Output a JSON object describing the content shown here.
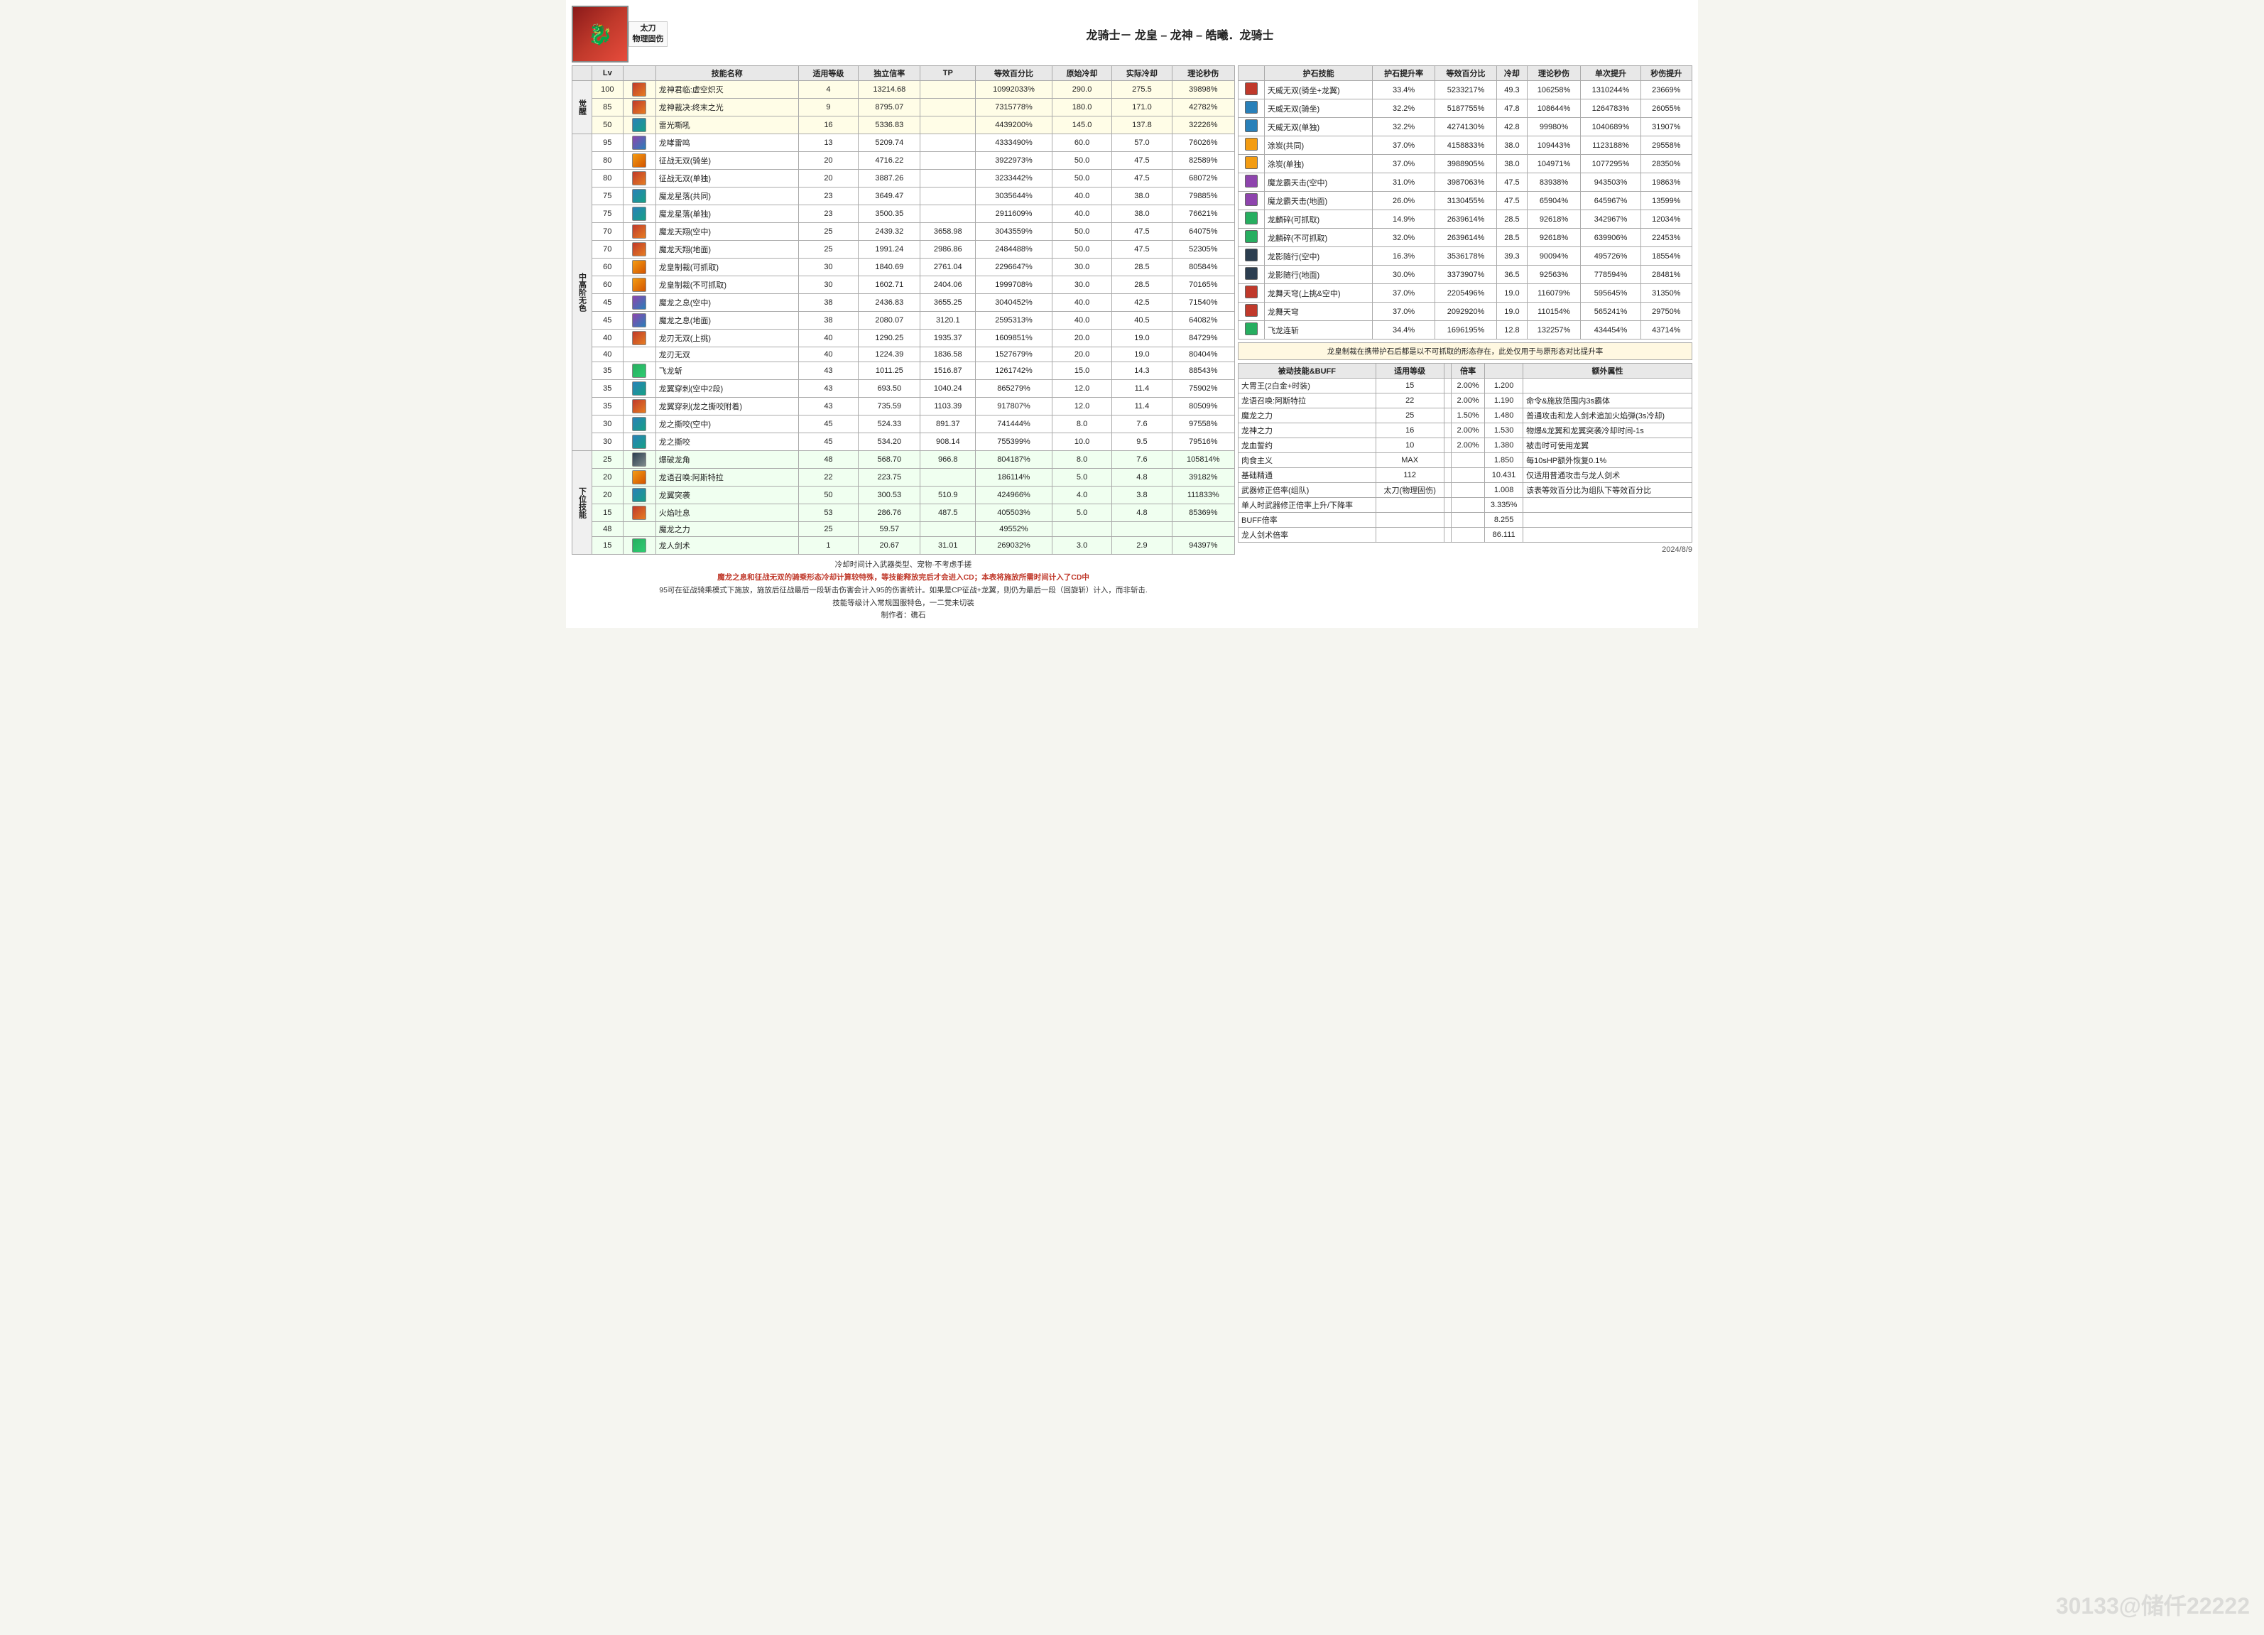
{
  "header": {
    "title": "龙骑士－ 龙皇 – 龙神 – 皓曦．龙骑士",
    "weapon_label": "太刀\n物理固伤",
    "avatar_char": "🐉"
  },
  "col_headers_left": [
    "",
    "技能名称",
    "适用等级",
    "独立信率",
    "TP",
    "等效百分比",
    "原始冷却",
    "实际冷却",
    "理论秒伤"
  ],
  "col_headers_right": [
    "护石技能",
    "护石提升率",
    "等效百分比",
    "冷却",
    "理论秒伤",
    "单次提升",
    "秒伤提升"
  ],
  "categories": {
    "awakened": "觉醒",
    "mid": "中高阶无色",
    "lower": "下位技能"
  },
  "skills": [
    {
      "cat": "觉醒",
      "lv": "100",
      "icon": "red",
      "name": "龙神君临:虚空炽灭",
      "grade": "4",
      "rate": "13214.68",
      "tp": "",
      "eff": "10992033%",
      "orig_cd": "290.0",
      "real_cd": "275.5",
      "dps": "39898%"
    },
    {
      "cat": "觉醒",
      "lv": "85",
      "icon": "red",
      "name": "龙神裁决:终末之光",
      "grade": "9",
      "rate": "8795.07",
      "tp": "",
      "eff": "7315778%",
      "orig_cd": "180.0",
      "real_cd": "171.0",
      "dps": "42782%"
    },
    {
      "cat": "觉醒",
      "lv": "50",
      "icon": "blue",
      "name": "雷光嘶吼",
      "grade": "16",
      "rate": "5336.83",
      "tp": "",
      "eff": "4439200%",
      "orig_cd": "145.0",
      "real_cd": "137.8",
      "dps": "32226%"
    },
    {
      "cat": "中高阶无色",
      "lv": "95",
      "icon": "purple",
      "name": "龙哮雷鸣",
      "grade": "13",
      "rate": "5209.74",
      "tp": "",
      "eff": "4333490%",
      "orig_cd": "60.0",
      "real_cd": "57.0",
      "dps": "76026%"
    },
    {
      "cat": "中高阶无色",
      "lv": "80",
      "icon": "gold",
      "name": "征战无双(骑坐)",
      "grade": "20",
      "rate": "4716.22",
      "tp": "",
      "eff": "3922973%",
      "orig_cd": "50.0",
      "real_cd": "47.5",
      "dps": "82589%"
    },
    {
      "cat": "中高阶无色",
      "lv": "80",
      "icon": "red",
      "name": "征战无双(单独)",
      "grade": "20",
      "rate": "3887.26",
      "tp": "",
      "eff": "3233442%",
      "orig_cd": "50.0",
      "real_cd": "47.5",
      "dps": "68072%"
    },
    {
      "cat": "中高阶无色",
      "lv": "75",
      "icon": "blue",
      "name": "魔龙星落(共同)",
      "grade": "23",
      "rate": "3649.47",
      "tp": "",
      "eff": "3035644%",
      "orig_cd": "40.0",
      "real_cd": "38.0",
      "dps": "79885%"
    },
    {
      "cat": "中高阶无色",
      "lv": "75",
      "icon": "blue",
      "name": "魔龙星落(单独)",
      "grade": "23",
      "rate": "3500.35",
      "tp": "",
      "eff": "2911609%",
      "orig_cd": "40.0",
      "real_cd": "38.0",
      "dps": "76621%"
    },
    {
      "cat": "中高阶无色",
      "lv": "70",
      "icon": "red",
      "name": "魔龙天翔(空中)",
      "grade": "25",
      "rate": "2439.32",
      "tp": "3658.98",
      "eff": "3043559%",
      "orig_cd": "50.0",
      "real_cd": "47.5",
      "dps": "64075%"
    },
    {
      "cat": "中高阶无色",
      "lv": "70",
      "icon": "red",
      "name": "魔龙天翔(地面)",
      "grade": "25",
      "rate": "1991.24",
      "tp": "2986.86",
      "eff": "2484488%",
      "orig_cd": "50.0",
      "real_cd": "47.5",
      "dps": "52305%"
    },
    {
      "cat": "中高阶无色",
      "lv": "60",
      "icon": "gold",
      "name": "龙皇制裁(可抓取)",
      "grade": "30",
      "rate": "1840.69",
      "tp": "2761.04",
      "eff": "2296647%",
      "orig_cd": "30.0",
      "real_cd": "28.5",
      "dps": "80584%"
    },
    {
      "cat": "中高阶无色",
      "lv": "60",
      "icon": "gold",
      "name": "龙皇制裁(不可抓取)",
      "grade": "30",
      "rate": "1602.71",
      "tp": "2404.06",
      "eff": "1999708%",
      "orig_cd": "30.0",
      "real_cd": "28.5",
      "dps": "70165%"
    },
    {
      "cat": "中高阶无色",
      "lv": "45",
      "icon": "purple",
      "name": "魔龙之息(空中)",
      "grade": "38",
      "rate": "2436.83",
      "tp": "3655.25",
      "eff": "3040452%",
      "orig_cd": "40.0",
      "real_cd": "42.5",
      "dps": "71540%"
    },
    {
      "cat": "中高阶无色",
      "lv": "45",
      "icon": "purple",
      "name": "魔龙之息(地面)",
      "grade": "38",
      "rate": "2080.07",
      "tp": "3120.1",
      "eff": "2595313%",
      "orig_cd": "40.0",
      "real_cd": "40.5",
      "dps": "64082%"
    },
    {
      "cat": "中高阶无色",
      "lv": "40",
      "icon": "red",
      "name": "龙刃无双(上挑)",
      "grade": "40",
      "rate": "1290.25",
      "tp": "1935.37",
      "eff": "1609851%",
      "orig_cd": "20.0",
      "real_cd": "19.0",
      "dps": "84729%"
    },
    {
      "cat": "中高阶无色",
      "lv": "40",
      "icon": "",
      "name": "龙刃无双",
      "grade": "40",
      "rate": "1224.39",
      "tp": "1836.58",
      "eff": "1527679%",
      "orig_cd": "20.0",
      "real_cd": "19.0",
      "dps": "80404%"
    },
    {
      "cat": "中高阶无色",
      "lv": "35",
      "icon": "green",
      "name": "飞龙斩",
      "grade": "43",
      "rate": "1011.25",
      "tp": "1516.87",
      "eff": "1261742%",
      "orig_cd": "15.0",
      "real_cd": "14.3",
      "dps": "88543%"
    },
    {
      "cat": "中高阶无色",
      "lv": "35",
      "icon": "blue",
      "name": "龙翼穿刺(空中2段)",
      "grade": "43",
      "rate": "693.50",
      "tp": "1040.24",
      "eff": "865279%",
      "orig_cd": "12.0",
      "real_cd": "11.4",
      "dps": "75902%"
    },
    {
      "cat": "中高阶无色",
      "lv": "35",
      "icon": "red",
      "name": "龙翼穿刺(龙之撕咬附着)",
      "grade": "43",
      "rate": "735.59",
      "tp": "1103.39",
      "eff": "917807%",
      "orig_cd": "12.0",
      "real_cd": "11.4",
      "dps": "80509%"
    },
    {
      "cat": "中高阶无色",
      "lv": "30",
      "icon": "blue",
      "name": "龙之撕咬(空中)",
      "grade": "45",
      "rate": "524.33",
      "tp": "891.37",
      "eff": "741444%",
      "orig_cd": "8.0",
      "real_cd": "7.6",
      "dps": "97558%"
    },
    {
      "cat": "中高阶无色",
      "lv": "30",
      "icon": "blue",
      "name": "龙之撕咬",
      "grade": "45",
      "rate": "534.20",
      "tp": "908.14",
      "eff": "755399%",
      "orig_cd": "10.0",
      "real_cd": "9.5",
      "dps": "79516%"
    },
    {
      "cat": "下位技能",
      "lv": "25",
      "icon": "dark",
      "name": "爆破龙角",
      "grade": "48",
      "rate": "568.70",
      "tp": "966.8",
      "eff": "804187%",
      "orig_cd": "8.0",
      "real_cd": "7.6",
      "dps": "105814%"
    },
    {
      "cat": "下位技能",
      "lv": "20",
      "icon": "gold",
      "name": "龙语召唤:阿斯特拉",
      "grade": "22",
      "rate": "223.75",
      "tp": "",
      "eff": "186114%",
      "orig_cd": "5.0",
      "real_cd": "4.8",
      "dps": "39182%"
    },
    {
      "cat": "下位技能",
      "lv": "20",
      "icon": "blue",
      "name": "龙翼突袭",
      "grade": "50",
      "rate": "300.53",
      "tp": "510.9",
      "eff": "424966%",
      "orig_cd": "4.0",
      "real_cd": "3.8",
      "dps": "111833%"
    },
    {
      "cat": "下位技能",
      "lv": "15",
      "icon": "red",
      "name": "火焰吐息",
      "grade": "53",
      "rate": "286.76",
      "tp": "487.5",
      "eff": "405503%",
      "orig_cd": "5.0",
      "real_cd": "4.8",
      "dps": "85369%"
    },
    {
      "cat": "下位技能",
      "lv": "48",
      "icon": "",
      "name": "魔龙之力",
      "grade": "25",
      "rate": "59.57",
      "tp": "",
      "eff": "49552%",
      "orig_cd": "",
      "real_cd": "",
      "dps": ""
    },
    {
      "cat": "下位技能",
      "lv": "15",
      "icon": "green",
      "name": "龙人剑术",
      "grade": "1",
      "rate": "20.67",
      "tp": "31.01",
      "eff": "269032%",
      "orig_cd": "3.0",
      "real_cd": "2.9",
      "dps": "94397%"
    }
  ],
  "right_skills": [
    {
      "name": "天威无双(骑坐+龙翼)",
      "boost": "33.4%",
      "eff": "5233217%",
      "cd": "49.3",
      "dps": "106258%",
      "single": "1310244%",
      "sdps": "23669%"
    },
    {
      "name": "天威无双(骑坐)",
      "boost": "32.2%",
      "eff": "5187755%",
      "cd": "47.8",
      "dps": "108644%",
      "single": "1264783%",
      "sdps": "26055%"
    },
    {
      "name": "天威无双(单独)",
      "boost": "32.2%",
      "eff": "4274130%",
      "cd": "42.8",
      "dps": "99980%",
      "single": "1040689%",
      "sdps": "31907%"
    },
    {
      "name": "涂炭(共同)",
      "boost": "37.0%",
      "eff": "4158833%",
      "cd": "38.0",
      "dps": "109443%",
      "single": "1123188%",
      "sdps": "29558%"
    },
    {
      "name": "涂炭(单独)",
      "boost": "37.0%",
      "eff": "3988905%",
      "cd": "38.0",
      "dps": "104971%",
      "single": "1077295%",
      "sdps": "28350%"
    },
    {
      "name": "魔龙霸天击(空中)",
      "boost": "31.0%",
      "eff": "3987063%",
      "cd": "47.5",
      "dps": "83938%",
      "single": "943503%",
      "sdps": "19863%"
    },
    {
      "name": "魔龙霸天击(地面)",
      "boost": "26.0%",
      "eff": "3130455%",
      "cd": "47.5",
      "dps": "65904%",
      "single": "645967%",
      "sdps": "13599%"
    },
    {
      "name": "龙麟碎(可抓取)",
      "boost": "14.9%",
      "eff": "2639614%",
      "cd": "28.5",
      "dps": "92618%",
      "single": "342967%",
      "sdps": "12034%"
    },
    {
      "name": "龙麟碎(不可抓取)",
      "boost": "32.0%",
      "eff": "2639614%",
      "cd": "28.5",
      "dps": "92618%",
      "single": "639906%",
      "sdps": "22453%"
    },
    {
      "name": "龙影随行(空中)",
      "boost": "16.3%",
      "eff": "3536178%",
      "cd": "39.3",
      "dps": "90094%",
      "single": "495726%",
      "sdps": "18554%"
    },
    {
      "name": "龙影随行(地面)",
      "boost": "30.0%",
      "eff": "3373907%",
      "cd": "36.5",
      "dps": "92563%",
      "single": "778594%",
      "sdps": "28481%"
    },
    {
      "name": "龙舞天穹(上挑&空中)",
      "boost": "37.0%",
      "eff": "2205496%",
      "cd": "19.0",
      "dps": "116079%",
      "single": "595645%",
      "sdps": "31350%"
    },
    {
      "name": "龙舞天穹",
      "boost": "37.0%",
      "eff": "2092920%",
      "cd": "19.0",
      "dps": "110154%",
      "single": "565241%",
      "sdps": "29750%"
    },
    {
      "name": "飞龙连斩",
      "boost": "34.4%",
      "eff": "1696195%",
      "cd": "12.8",
      "dps": "132257%",
      "single": "434454%",
      "sdps": "43714%"
    }
  ],
  "buff_table": {
    "headers": [
      "被动技能&BUFF",
      "适用等级",
      "",
      "倍率",
      "",
      "额外属性"
    ],
    "rows": [
      {
        "name": "大胃王(2白金+时装)",
        "lv": "15",
        "blank": "",
        "rate": "2.00%",
        "blank2": "1.200",
        "note": ""
      },
      {
        "name": "龙语召唤:阿斯特拉",
        "lv": "22",
        "blank": "",
        "rate": "2.00%",
        "blank2": "1.190",
        "note": "命令&施放范围内3s霸体"
      },
      {
        "name": "魔龙之力",
        "lv": "25",
        "blank": "",
        "rate": "1.50%",
        "blank2": "1.480",
        "note": "普通攻击和龙人剑术追加火焰弹(3s冷却)"
      },
      {
        "name": "龙神之力",
        "lv": "16",
        "blank": "",
        "rate": "2.00%",
        "blank2": "1.530",
        "note": "物爆&龙翼和龙翼突袭冷却时间-1s"
      },
      {
        "name": "龙血誓约",
        "lv": "10",
        "blank": "",
        "rate": "2.00%",
        "blank2": "1.380",
        "note": "被击时可使用龙翼"
      },
      {
        "name": "肉食主义",
        "lv": "MAX",
        "blank": "",
        "rate": "",
        "blank2": "1.850",
        "note": "每10sHP额外恢复0.1%"
      },
      {
        "name": "基础精通",
        "lv": "112",
        "blank": "",
        "rate": "",
        "blank2": "10.431",
        "note": "仅适用普通攻击与龙人剑术"
      },
      {
        "name": "武器修正倍率(组队)",
        "lv": "太刀(物理固伤)",
        "blank": "",
        "rate": "",
        "blank2": "1.008",
        "note": "该表等效百分比为组队下等效百分比"
      },
      {
        "name": "单人时武器修正倍率上升/下降率",
        "lv": "",
        "blank": "",
        "rate": "",
        "blank2": "3.335%",
        "note": ""
      },
      {
        "name": "BUFF倍率",
        "lv": "",
        "blank": "",
        "rate": "",
        "blank2": "8.255",
        "note": ""
      },
      {
        "name": "龙人剑术倍率",
        "lv": "",
        "blank": "",
        "rate": "",
        "blank2": "86.111",
        "note": ""
      }
    ]
  },
  "notes": {
    "line1": "冷却时间计入武器类型、宠物·不考虑手搓",
    "line2_red": "魔龙之息和征战无双的骑乘形态冷却计算较特殊，等技能释放完后才会进入CD；本表将施放所需时间计入了CD中",
    "line3": "95可在征战骑乘模式下施放，施放后征战最后一段斩击伤害会计入95的伤害统计。如果是CP征战+龙翼，则仍为最后一段（回旋斩）计入，而非斩击.",
    "line4": "技能等级计入常规国服特色，一二觉未切装",
    "line5": "制作者：礁石",
    "date": "2024/8/9"
  },
  "watermark": "30133@储仟22222"
}
